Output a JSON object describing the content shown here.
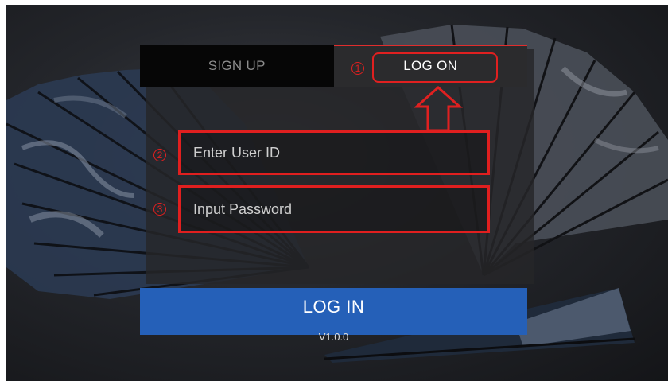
{
  "tabs": {
    "signup_label": "SIGN UP",
    "logon_label": "LOG ON",
    "active": "LOG ON"
  },
  "annotations": {
    "step1": "1",
    "step2": "2",
    "step3": "3",
    "color": "#e02020"
  },
  "form": {
    "user_id_placeholder": "Enter User ID",
    "password_placeholder": "Input Password"
  },
  "login_button_label": "LOG IN",
  "version": "V1.0.0",
  "colors": {
    "primary_button": "#2560b8",
    "highlight": "#e02020"
  }
}
